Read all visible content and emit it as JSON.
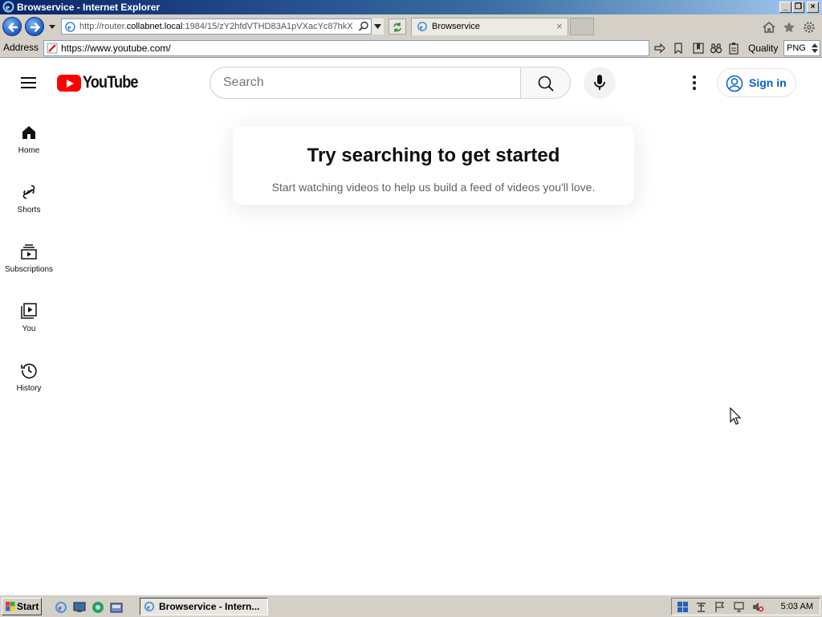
{
  "window": {
    "title": "Browservice - Internet Explorer"
  },
  "navbar": {
    "url_prefix": "http://router.",
    "url_host": "collabnet.local",
    "url_rest": ":1984/15/zY2hfdVTHD83A1pVXacYc87hkX",
    "tab_title": "Browservice"
  },
  "addressbar": {
    "label": "Address",
    "value": "https://www.youtube.com/",
    "quality_label": "Quality",
    "format_value": "PNG"
  },
  "youtube": {
    "logo_text": "YouTube",
    "search_placeholder": "Search",
    "signin_label": "Sign in",
    "guide": [
      {
        "label": "Home",
        "icon": "home-icon"
      },
      {
        "label": "Shorts",
        "icon": "shorts-icon"
      },
      {
        "label": "Subscriptions",
        "icon": "subscriptions-icon"
      },
      {
        "label": "You",
        "icon": "you-icon"
      },
      {
        "label": "History",
        "icon": "history-icon"
      }
    ],
    "prompt_title": "Try searching to get started",
    "prompt_subtitle": "Start watching videos to help us build a feed of videos you'll love."
  },
  "taskbar": {
    "start_label": "Start",
    "task_label": "Browservice - Intern...",
    "clock": "5:03 AM"
  },
  "colors": {
    "youtube_red": "#ff0000",
    "link_blue": "#065fd4",
    "title_bar": "#0a246a",
    "chrome_gray": "#d4d0c8"
  }
}
